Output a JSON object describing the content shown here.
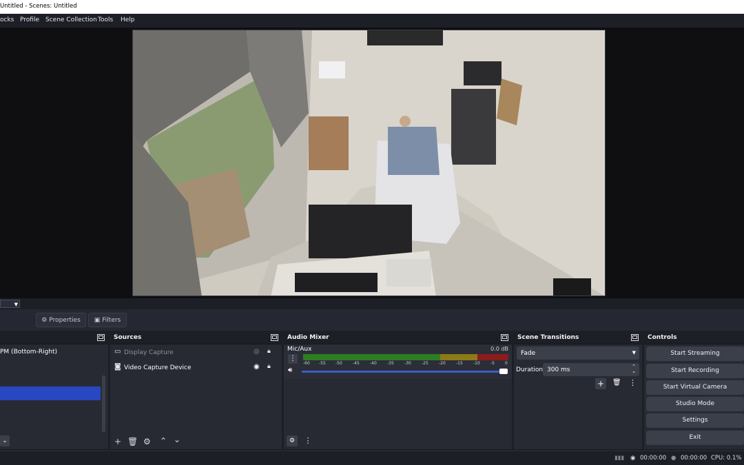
{
  "window": {
    "title": "Untitled - Scenes: Untitled"
  },
  "menu": [
    "ocks",
    "Profile",
    "Scene Collection",
    "Tools",
    "Help"
  ],
  "context": {
    "properties": "Properties",
    "filters": "Filters"
  },
  "scenes": {
    "label": "",
    "items": [
      "PM (Bottom-Right)"
    ]
  },
  "sources": {
    "label": "Sources",
    "items": [
      {
        "name": "Display Capture",
        "icon": "monitor-icon",
        "visible": false
      },
      {
        "name": "Video Capture Device",
        "icon": "camera-icon",
        "visible": true
      }
    ]
  },
  "mixer": {
    "label": "Audio Mixer",
    "channel": {
      "name": "Mic/Aux",
      "db": "0.0 dB",
      "volume_fraction": 1.0
    },
    "ticks": [
      "-60",
      "-55",
      "-50",
      "-45",
      "-40",
      "-35",
      "-30",
      "-25",
      "-20",
      "-15",
      "-10",
      "-5",
      "0"
    ]
  },
  "transitions": {
    "label": "Scene Transitions",
    "selected": "Fade",
    "duration_label": "Duration",
    "duration_value": "300 ms"
  },
  "controls": {
    "label": "Controls",
    "buttons": [
      "Start Streaming",
      "Start Recording",
      "Start Virtual Camera",
      "Studio Mode",
      "Settings",
      "Exit"
    ]
  },
  "status": {
    "stream_time": "00:00:00",
    "record_time": "00:00:00",
    "cpu": "CPU: 0.1%"
  },
  "colors": {
    "accent": "#2847c0",
    "panel": "#272a33",
    "background": "#1d1f26",
    "button": "#3b3f4a"
  }
}
